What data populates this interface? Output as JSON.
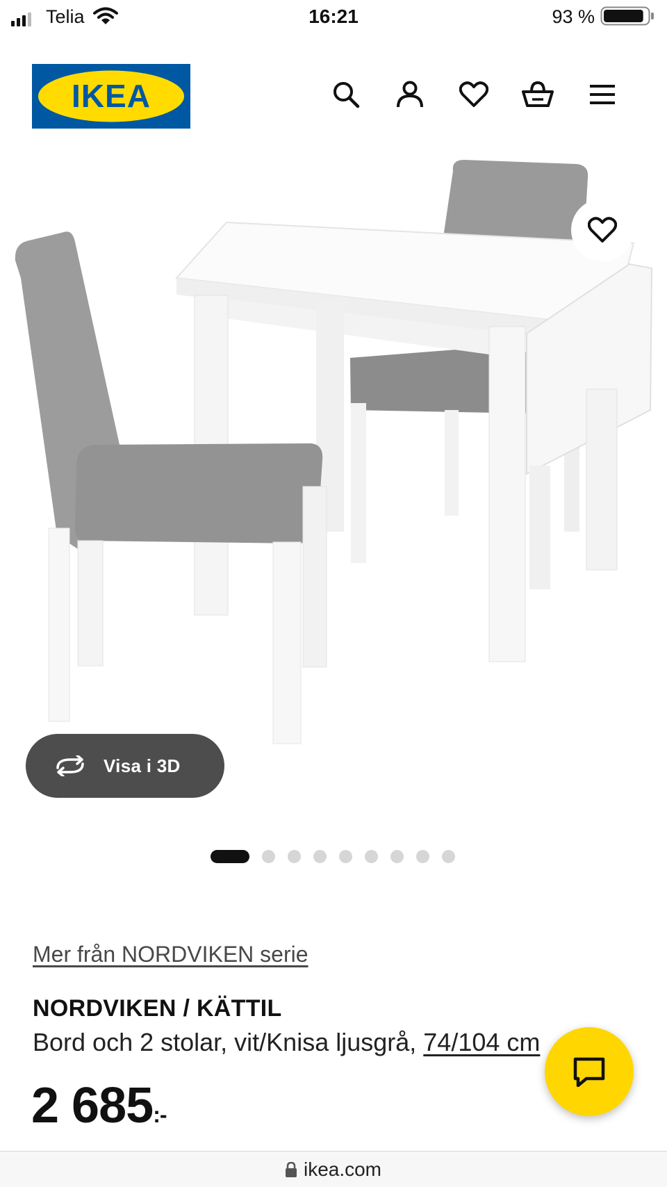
{
  "status_bar": {
    "carrier": "Telia",
    "time": "16:21",
    "battery_percent": "93 %",
    "battery_level": 0.93
  },
  "header": {
    "logo_text": "IKEA",
    "brand_colors": {
      "blue": "#0058a3",
      "yellow": "#ffdb00"
    },
    "icons": [
      "search-icon",
      "account-icon",
      "wishlist-icon",
      "cart-icon",
      "menu-icon"
    ]
  },
  "gallery": {
    "image_count": 9,
    "active_index": 0,
    "view_3d_label": "Visa i 3D"
  },
  "product": {
    "series_link": "Mer från NORDVIKEN serie",
    "name": "NORDVIKEN / KÄTTIL",
    "description": "Bord och 2 stolar, vit/Knisa ljusgrå, ",
    "size_link": "74/104 cm",
    "price": "2 685",
    "price_suffix": ":-"
  },
  "chat": {
    "accent_color": "#ffd600"
  },
  "browser": {
    "url": "ikea.com"
  }
}
